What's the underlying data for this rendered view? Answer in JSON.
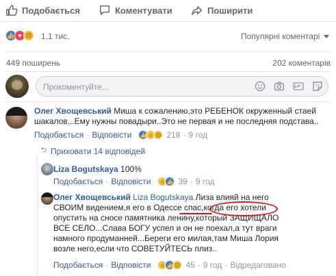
{
  "actions": {
    "like_label": "Подобається",
    "comment_label": "Коментувати",
    "share_label": "Поширити"
  },
  "reactions": {
    "count": "1,1 тис.",
    "icons": [
      "like-icon",
      "love-icon",
      "sad-icon"
    ]
  },
  "sort": {
    "label": "Популярні коментарі"
  },
  "stats": {
    "shares": "449 поширень",
    "comments": "202 коментарів"
  },
  "composer": {
    "placeholder": "Прокоментуйте..."
  },
  "comments": [
    {
      "author": "Олег Хвощевський",
      "text": "Миша к сожалению,это РЕБЕНОК окруженный стаей шакалов...Ему нужны повадыри..Это не первая и не последняя подстава..",
      "like_label": "Подобається",
      "reply_label": "Відповісти",
      "reaction_count": "218",
      "time": "9 год"
    }
  ],
  "hide_replies_label": "Приховати 14 відповідей",
  "replies": [
    {
      "author": "Liza Bogutskaya",
      "text": "100%",
      "like_label": "Подобається",
      "reply_label": "Відповісти",
      "reaction_count": "39",
      "time": "9 год"
    },
    {
      "author": "Олег Хвощевський",
      "mention": "Liza Bogutskaya",
      "text": "Лиза влияй на него СВОИМ видением,я его в Одессе спас,когда его хотели опустить на сносе памятника ленину,который ЗАЩИЩАЛО ВСЕ СЕЛО...Слава БОГУ успел и он не поехал,а тут враги намного продуманней...Береги его милая,там Миша Лория возле него,если что СОВЕТУЙТЕСЬ плиз..",
      "like_label": "Подобається",
      "reply_label": "Відповісти",
      "reaction_count": "45",
      "time": "9 год",
      "edited_label": "Відредаговано"
    }
  ],
  "colors": {
    "link": "#385898",
    "muted": "#606770",
    "annotation": "#d11b1b"
  }
}
